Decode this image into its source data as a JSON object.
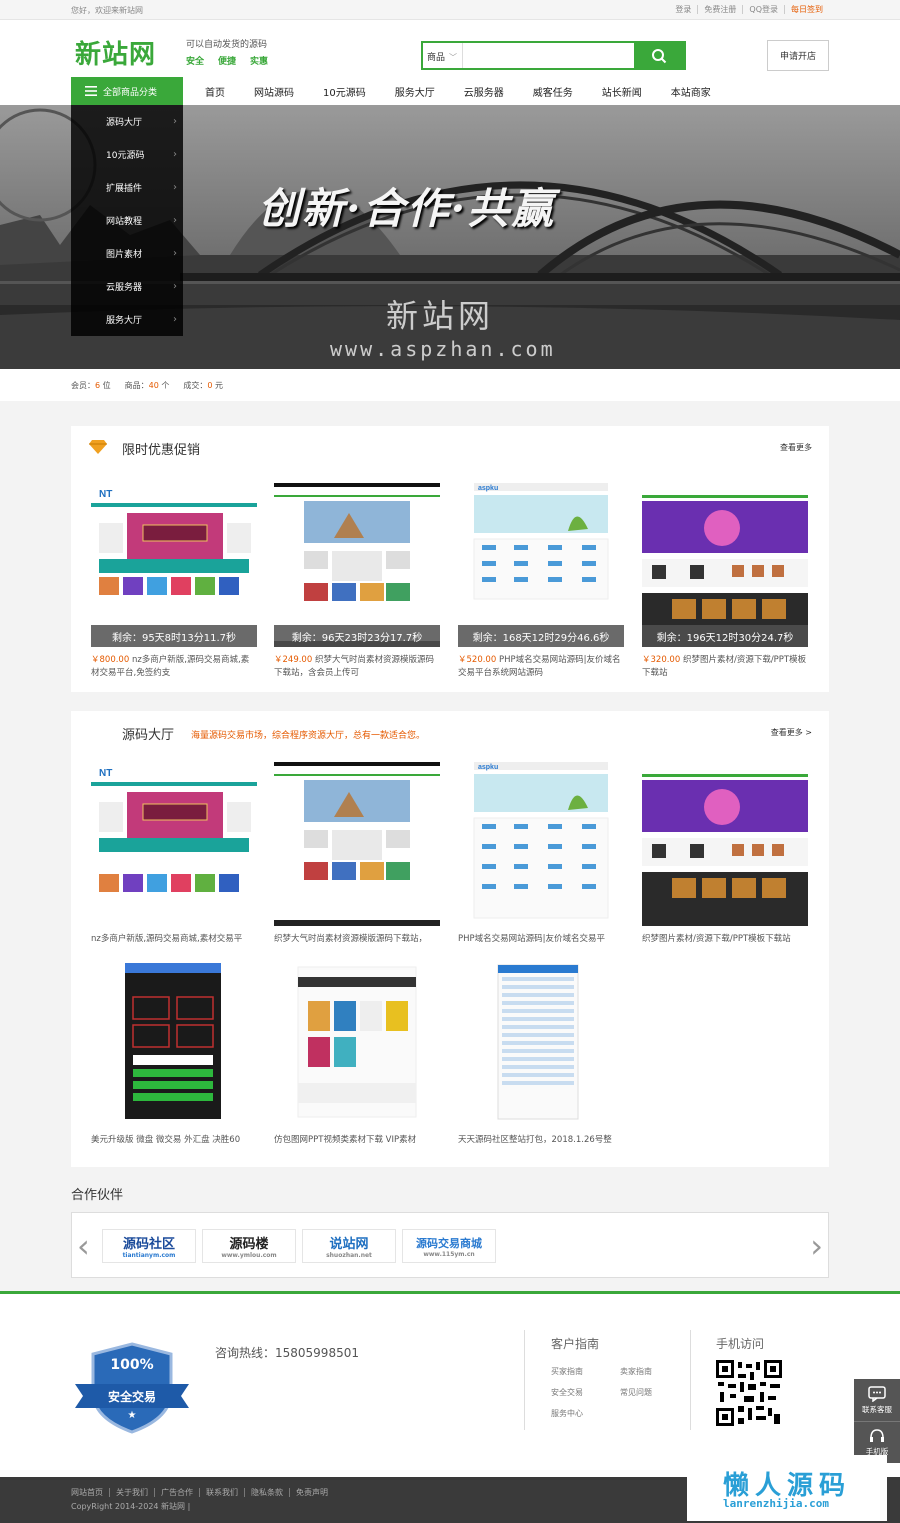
{
  "topbar": {
    "welcome": "您好，欢迎来新站网",
    "links": [
      "登录",
      "免费注册",
      "QQ登录",
      "每日签到"
    ]
  },
  "header": {
    "logo": "新站网",
    "slogan": "可以自动发货的源码",
    "tags": [
      "安全",
      "便捷",
      "实惠"
    ],
    "search_category": "商品",
    "search_placeholder": "",
    "open_store": "申请开店"
  },
  "nav": {
    "all_categories": "全部商品分类",
    "links": [
      "首页",
      "网站源码",
      "10元源码",
      "服务大厅",
      "云服务器",
      "威客任务",
      "站长新闻",
      "本站商家"
    ]
  },
  "category_menu": [
    "源码大厅",
    "10元源码",
    "扩展插件",
    "网站教程",
    "图片素材",
    "云服务器",
    "服务大厅"
  ],
  "banner": {
    "headline": "创新·合作·共赢",
    "brand": "新站网",
    "url": "www.aspzhan.com"
  },
  "stats": {
    "members_label": "会员：",
    "members": "6",
    "members_unit": "位",
    "goods_label": "商品：",
    "goods": "40",
    "goods_unit": "个",
    "deals_label": "成交：",
    "deals": "0",
    "deals_unit": "元"
  },
  "promo": {
    "title": "限时优惠促销",
    "more": "查看更多",
    "items": [
      {
        "timer": "剩余：95天8时13分11.7秒",
        "price": "￥800.00",
        "name": "nz多商户新版,源码交易商城,素材交易平台,免签约支"
      },
      {
        "timer": "剩余：96天23时23分17.7秒",
        "price": "￥249.00",
        "name": "织梦大气时尚素材资源模版源码下载站，含会员上传可"
      },
      {
        "timer": "剩余：168天12时29分46.6秒",
        "price": "￥520.00",
        "name": "PHP域名交易网站源码|友价域名交易平台系统网站源码"
      },
      {
        "timer": "剩余：196天12时30分24.7秒",
        "price": "￥320.00",
        "name": "织梦图片素材/资源下载/PPT模板下载站"
      }
    ]
  },
  "source_hall": {
    "title": "源码大厅",
    "desc": "海量源码交易市场，综合程序资源大厅，总有一款适合您。",
    "more": "查看更多 >",
    "items": [
      "nz多商户新版,源码交易商城,素材交易平",
      "织梦大气时尚素材资源模版源码下载站，",
      "PHP域名交易网站源码|友价域名交易平",
      "织梦图片素材/资源下载/PPT模板下载站",
      "美元升级版 微盘 微交易 外汇盘 决胜60",
      "仿包图网PPT视频类素材下载 VIP素材",
      "天天源码社区整站打包，2018.1.26号整"
    ]
  },
  "partners": {
    "title": "合作伙伴",
    "logos": [
      {
        "text": "源码社区",
        "sub": "tiantianym.com"
      },
      {
        "text": "源码楼",
        "sub": "www.ymlou.com"
      },
      {
        "text": "说站网",
        "sub": "shuozhan.net"
      },
      {
        "text": "源码交易商城",
        "sub": "www.115ym.cn"
      }
    ]
  },
  "footer": {
    "badge_top": "100%",
    "badge_text": "安全交易",
    "hotline": "咨询热线：15805998501",
    "guide_title": "客户指南",
    "guide_links": [
      "买家指南",
      "卖家指南",
      "安全交易",
      "常见问题",
      "服务中心"
    ],
    "mobile_title": "手机访问"
  },
  "sidebar": [
    "联系客服",
    "手机版"
  ],
  "bottom": {
    "links": [
      "网站首页",
      "关于我们",
      "广告合作",
      "联系我们",
      "隐私条款",
      "免责声明"
    ],
    "copyright": "CopyRight 2014-2024 新站网 |"
  },
  "watermark": {
    "title": "懒人源码",
    "url": "lanrenzhijia.com"
  },
  "colors": {
    "accent": "#3aa83a",
    "price": "#e55a00"
  }
}
